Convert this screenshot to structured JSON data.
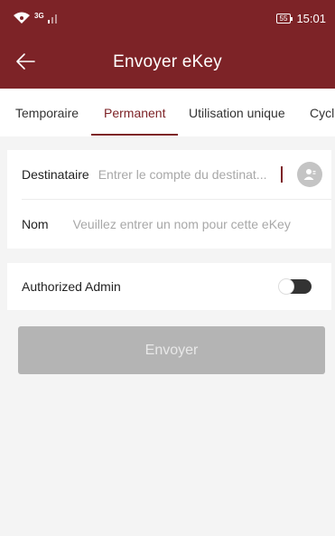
{
  "status_bar": {
    "network_type": "3G",
    "battery_level": "55",
    "time": "15:01"
  },
  "header": {
    "title": "Envoyer eKey",
    "back_icon": "arrow-left-icon"
  },
  "tabs": [
    {
      "label": "Temporaire",
      "active": false
    },
    {
      "label": "Permanent",
      "active": true
    },
    {
      "label": "Utilisation unique",
      "active": false
    },
    {
      "label": "Cycl",
      "active": false
    }
  ],
  "form": {
    "recipient": {
      "label": "Destinataire",
      "value": "",
      "placeholder": "Entrer le compte du destinat...",
      "contact_icon": "contact-person-icon"
    },
    "name": {
      "label": "Nom",
      "value": "",
      "placeholder": "Veuillez entrer un nom pour cette eKey"
    }
  },
  "admin": {
    "label": "Authorized Admin",
    "enabled": false
  },
  "submit": {
    "label": "Envoyer",
    "enabled": false
  },
  "colors": {
    "primary": "#7d2327",
    "disabled_button": "#b4b4b4",
    "background": "#f4f4f4"
  }
}
